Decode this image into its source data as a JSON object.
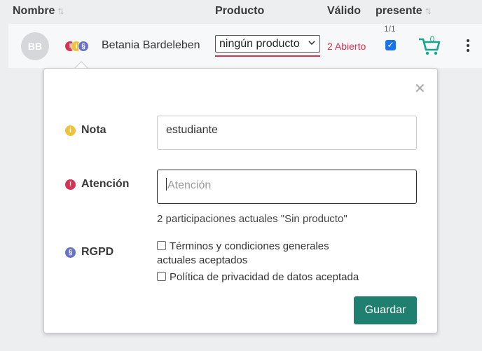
{
  "table_header": {
    "col_nombre": "Nombre",
    "col_producto": "Producto",
    "col_valido": "Válido",
    "col_presente": "presente",
    "sort_icon": "sort-arrows-icon"
  },
  "row": {
    "initials": "BB",
    "badges": [
      {
        "glyph": "!",
        "color": "#d63350",
        "icon": "attention-icon"
      },
      {
        "glyph": "i",
        "color": "#f0c23a",
        "icon": "info-icon"
      },
      {
        "glyph": "§",
        "color": "#6572c7",
        "icon": "gdpr-icon"
      }
    ],
    "name": "Betania Bardeleben",
    "product_select": "ningún producto",
    "valid_status": "2 Abierto",
    "presence_count": "1/1",
    "present_checked": true,
    "cart_count": "0",
    "cart_icon": "cart-icon",
    "menu_icon": "more-vertical-icon"
  },
  "popover": {
    "close_icon": "close-icon",
    "nota": {
      "label": "Nota",
      "value": "estudiante",
      "icon": "info-icon",
      "color": "#f0c23a"
    },
    "atencion": {
      "label": "Atención",
      "placeholder": "Atención",
      "icon": "attention-icon",
      "color": "#d63350"
    },
    "participation_info": "2 participaciones actuales \"Sin producto\"",
    "rgpd": {
      "label": "RGPD",
      "icon": "gdpr-icon",
      "color": "#6572c7",
      "terms_line1": "Términos y condiciones generales",
      "terms_line2": "actuales aceptados",
      "privacy": "Política de privacidad de datos aceptada"
    },
    "save_label": "Guardar"
  },
  "colors": {
    "accent_red": "#d63350",
    "save_green": "#1f8070",
    "cart_teal": "#17a58c",
    "checkbox_blue": "#1a73e8"
  }
}
